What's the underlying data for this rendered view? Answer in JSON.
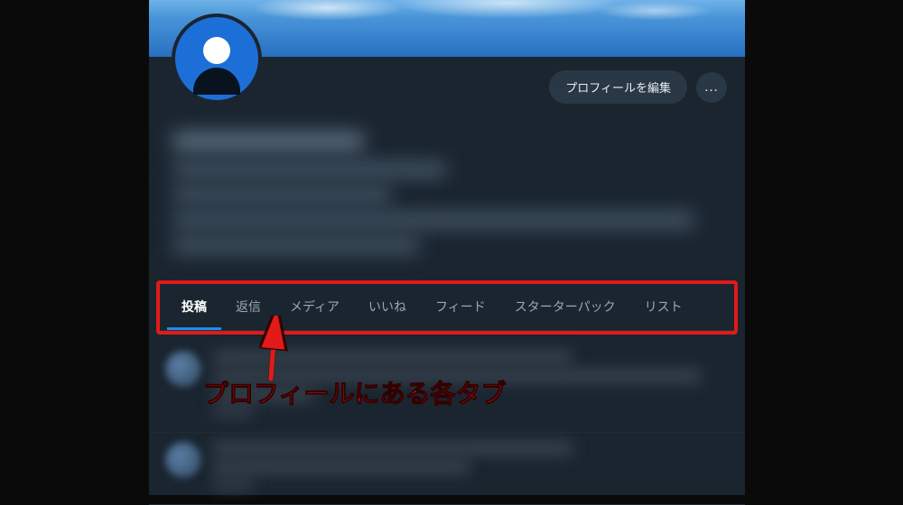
{
  "header": {
    "edit_profile_label": "プロフィールを編集",
    "more_label": "…"
  },
  "tabs": [
    {
      "label": "投稿",
      "active": true
    },
    {
      "label": "返信",
      "active": false
    },
    {
      "label": "メディア",
      "active": false
    },
    {
      "label": "いいね",
      "active": false
    },
    {
      "label": "フィード",
      "active": false
    },
    {
      "label": "スターターパック",
      "active": false
    },
    {
      "label": "リスト",
      "active": false
    }
  ],
  "annotation": {
    "text": "プロフィールにある各タブ",
    "highlight_color": "#e11a1a"
  }
}
